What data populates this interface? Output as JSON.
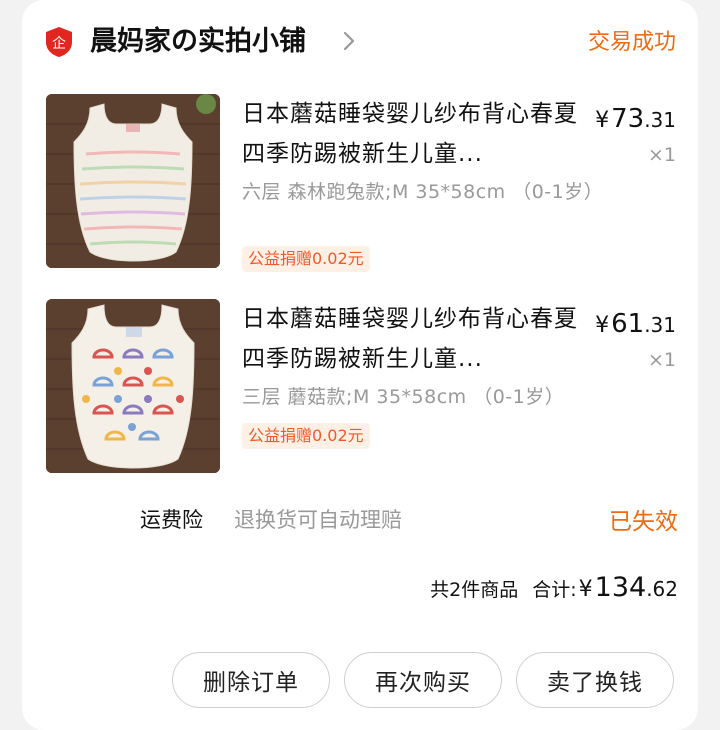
{
  "shop": {
    "name": "晨妈家の实拍小铺",
    "badge_icon": "shop-badge-icon",
    "badge_text": "企",
    "status": "交易成功"
  },
  "products": [
    {
      "title": "日本蘑菇睡袋婴儿纱布背心春夏四季防踢被新生儿童...",
      "price_currency": "¥",
      "price_int": "73",
      "price_dec": ".31",
      "qty": "×1",
      "sku": "六层  森林跑兔款;M 35*58cm （0-1岁）",
      "tag": "公益捐赠0.02元"
    },
    {
      "title": "日本蘑菇睡袋婴儿纱布背心春夏四季防踢被新生儿童...",
      "price_currency": "¥",
      "price_int": "61",
      "price_dec": ".31",
      "qty": "×1",
      "sku": "三层  蘑菇款;M 35*58cm （0-1岁）",
      "tag": "公益捐赠0.02元"
    }
  ],
  "insurance": {
    "label": "运费险",
    "description": "退换货可自动理赔",
    "status": "已失效"
  },
  "summary": {
    "count": "共2件商品",
    "total_label": "合计:",
    "currency": "¥",
    "total_int": "134",
    "total_dec": ".62"
  },
  "actions": {
    "delete": "删除订单",
    "rebuy": "再次购买",
    "resell": "卖了换钱"
  },
  "colors": {
    "accent": "#f06a0f",
    "badge_red": "#e0261f",
    "tag_bg": "#fff0e6",
    "tag_text": "#f05a28"
  }
}
